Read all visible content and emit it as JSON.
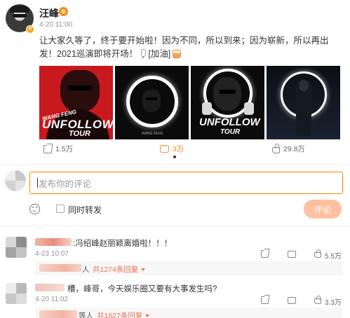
{
  "post": {
    "author": "汪峰",
    "time": "4-20 11:00",
    "text_part1": "让大家久等了，终于要开始啦！因为不同，所以到来；因为崭新，所以再出发！2021巡演即将开场！",
    "text_tag": "[加油]",
    "images": [
      {
        "icon": "unfollow-tour-red-poster",
        "script": "WANG FENG",
        "title": "UNFOLLOW",
        "subtitle": "TOUR"
      },
      {
        "icon": "ring-light-portrait",
        "signature": "WANG FENG"
      },
      {
        "icon": "ring-light-fists-poster",
        "title": "UNFOLLOW",
        "subtitle": "TOUR"
      },
      {
        "icon": "ring-light-standing-figure"
      }
    ],
    "actions": {
      "share_count": "1.5万",
      "comment_count": "3万",
      "like_count": "29.8万"
    }
  },
  "composer": {
    "placeholder": "发布你的评论",
    "repost_label": "同时转发",
    "submit_label": "评论",
    "accent": "#ff8200"
  },
  "comments": [
    {
      "text": ":冯绍峰赵丽颖离婚啦！！！",
      "time": "4-23 10:07",
      "likes": "5.5万",
      "reply_suffix": "人",
      "reply_count": "共1274条回复"
    },
    {
      "text": "槽，峰哥，今天娱乐圈又要有大事发生吗?",
      "time": "4-20 11:02",
      "likes": "3.3万",
      "reply_suffix": "等人",
      "reply_count": "共1627条回复"
    }
  ]
}
